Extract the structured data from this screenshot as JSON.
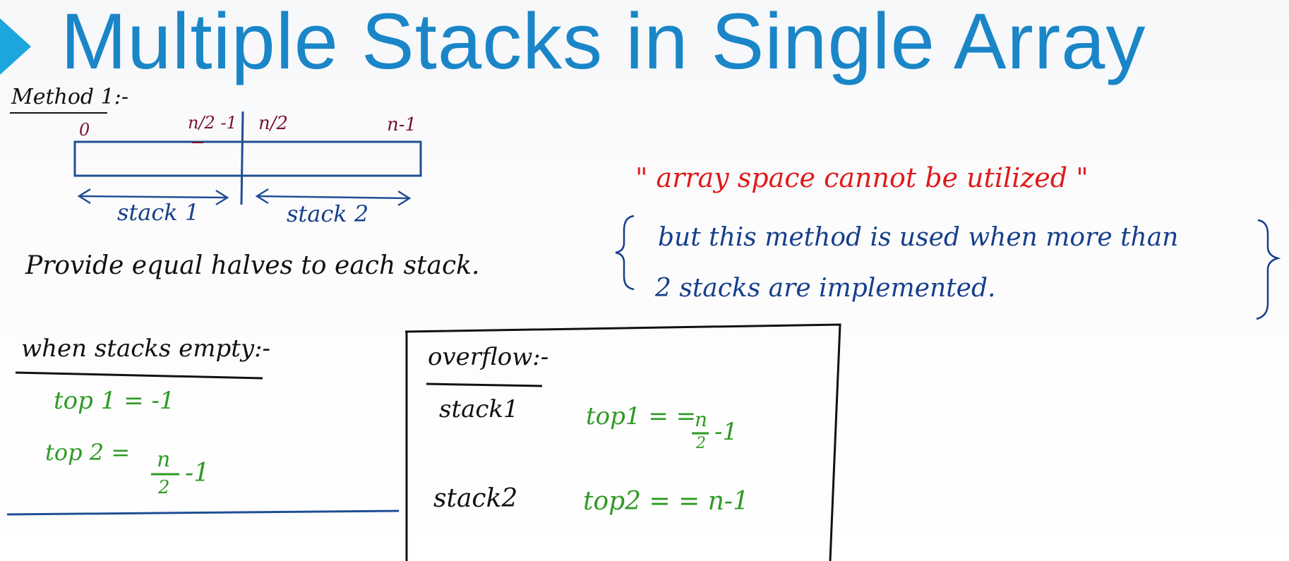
{
  "slide": {
    "title": "Multiple Stacks in Single Array"
  },
  "method": {
    "heading": "Method 1:-",
    "index_start": "0",
    "index_mid_left": "n/2 -1",
    "index_mid_right": "n/2",
    "index_end": "n-1",
    "stack1_label": "stack 1",
    "stack2_label": "stack 2",
    "description": "Provide equal halves to each stack."
  },
  "note": {
    "quote": "\" array space cannot be utilized \"",
    "line1": "but this method is used when more than",
    "line2": "2 stacks are implemented."
  },
  "empty": {
    "heading": "when stacks empty:-",
    "top1": "top 1  = -1",
    "top2_prefix": "top 2  =",
    "top2_frac_num": "n",
    "top2_frac_den": "2",
    "top2_suffix": "-1"
  },
  "overflow": {
    "heading": "overflow:-",
    "stack1_label": "stack1",
    "stack1_cond_prefix": "top1 = =",
    "stack1_frac_num": "n",
    "stack1_frac_den": "2",
    "stack1_cond_suffix": "-1",
    "stack2_label": "stack2",
    "stack2_cond": "top2 = =  n-1"
  },
  "colors": {
    "title": "#1a86c8",
    "accent_triangle": "#1ba6dd",
    "ink_black": "#111111",
    "ink_blue": "#163f8a",
    "ink_green": "#2e9a25",
    "ink_red": "#e01a1a",
    "ink_maroon": "#7a1230"
  }
}
